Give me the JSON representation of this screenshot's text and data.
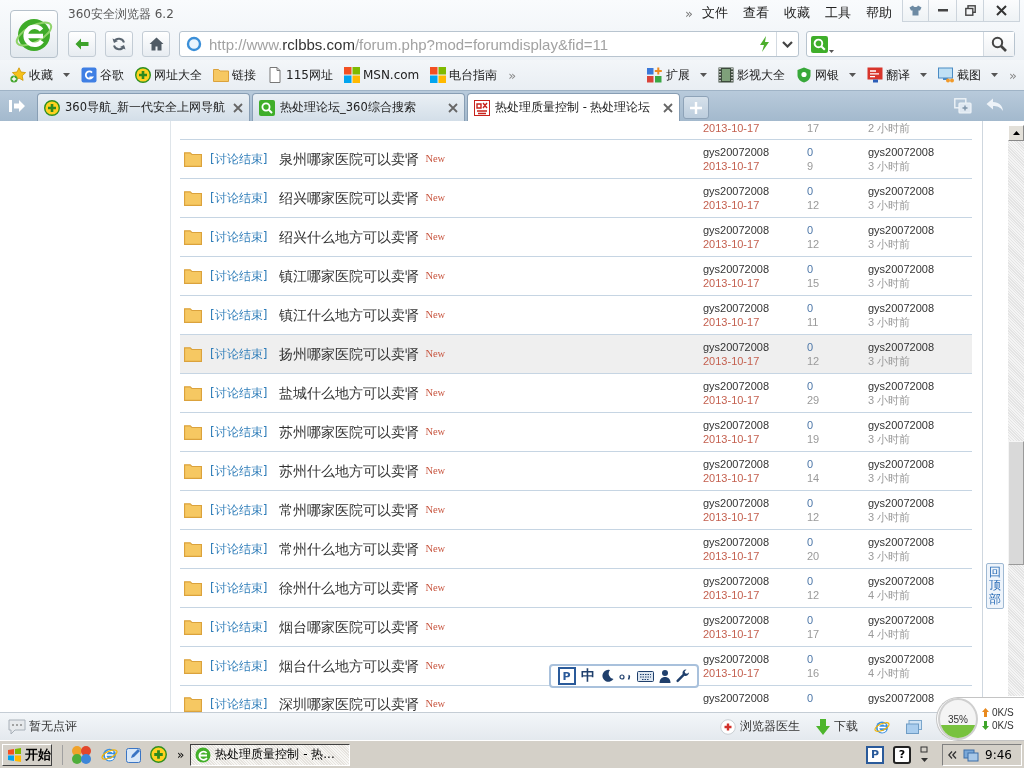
{
  "window": {
    "title": "360安全浏览器 6.2",
    "menu_more": "»",
    "menu": [
      "文件",
      "查看",
      "收藏",
      "工具",
      "帮助"
    ]
  },
  "address_bar": {
    "prefix": "http://www.",
    "domain": "rclbbs.com",
    "path": "/forum.php?mod=forumdisplay&fid=11"
  },
  "bookmarks": {
    "left": [
      {
        "kind": "favorites",
        "label": "收藏",
        "menu": true
      },
      {
        "kind": "search",
        "label": "谷歌",
        "menu": false
      },
      {
        "kind": "portal",
        "label": "网址大全",
        "menu": false
      },
      {
        "kind": "folder",
        "label": "链接",
        "menu": false
      },
      {
        "kind": "page",
        "label": "115网址",
        "menu": false
      },
      {
        "kind": "squares",
        "label": "MSN.com",
        "menu": false
      },
      {
        "kind": "squares",
        "label": "电台指南",
        "menu": false
      }
    ],
    "left_more": "»",
    "right": [
      {
        "kind": "extensions",
        "label": "扩展",
        "menu": true
      },
      {
        "kind": "video",
        "label": "影视大全",
        "menu": false
      },
      {
        "kind": "bank",
        "label": "网银",
        "menu": true
      },
      {
        "kind": "translate",
        "label": "翻译",
        "menu": true
      },
      {
        "kind": "screenshot",
        "label": "截图",
        "menu": true
      }
    ],
    "right_more": "»"
  },
  "tabs": [
    {
      "kind": "portal",
      "title": "360导航_新一代安全上网导航",
      "selected": false
    },
    {
      "kind": "search",
      "title": "热处理论坛_360综合搜索",
      "selected": false
    },
    {
      "kind": "forum",
      "title": "热处理质量控制 - 热处理论坛",
      "selected": true
    }
  ],
  "thread_list": {
    "rows": [
      {
        "kind": "partial_top",
        "date": "2013-10-17",
        "views": "17",
        "last_time": "2 小时前"
      },
      {
        "kind": "full",
        "prefix": "[讨论结束]",
        "title": "泉州哪家医院可以卖肾",
        "badge": "New",
        "author": "gys20072008",
        "date": "2013-10-17",
        "replies": "0",
        "views": "9",
        "last_poster": "gys20072008",
        "last_time": "3 小时前",
        "highlighted": false
      },
      {
        "kind": "full",
        "prefix": "[讨论结束]",
        "title": "绍兴哪家医院可以卖肾",
        "badge": "New",
        "author": "gys20072008",
        "date": "2013-10-17",
        "replies": "0",
        "views": "12",
        "last_poster": "gys20072008",
        "last_time": "3 小时前",
        "highlighted": false
      },
      {
        "kind": "full",
        "prefix": "[讨论结束]",
        "title": "绍兴什么地方可以卖肾",
        "badge": "New",
        "author": "gys20072008",
        "date": "2013-10-17",
        "replies": "0",
        "views": "12",
        "last_poster": "gys20072008",
        "last_time": "3 小时前",
        "highlighted": false
      },
      {
        "kind": "full",
        "prefix": "[讨论结束]",
        "title": "镇江哪家医院可以卖肾",
        "badge": "New",
        "author": "gys20072008",
        "date": "2013-10-17",
        "replies": "0",
        "views": "15",
        "last_poster": "gys20072008",
        "last_time": "3 小时前",
        "highlighted": false
      },
      {
        "kind": "full",
        "prefix": "[讨论结束]",
        "title": "镇江什么地方可以卖肾",
        "badge": "New",
        "author": "gys20072008",
        "date": "2013-10-17",
        "replies": "0",
        "views": "11",
        "last_poster": "gys20072008",
        "last_time": "3 小时前",
        "highlighted": false
      },
      {
        "kind": "full",
        "prefix": "[讨论结束]",
        "title": "扬州哪家医院可以卖肾",
        "badge": "New",
        "author": "gys20072008",
        "date": "2013-10-17",
        "replies": "0",
        "views": "12",
        "last_poster": "gys20072008",
        "last_time": "3 小时前",
        "highlighted": true
      },
      {
        "kind": "full",
        "prefix": "[讨论结束]",
        "title": "盐城什么地方可以卖肾",
        "badge": "New",
        "author": "gys20072008",
        "date": "2013-10-17",
        "replies": "0",
        "views": "29",
        "last_poster": "gys20072008",
        "last_time": "3 小时前",
        "highlighted": false
      },
      {
        "kind": "full",
        "prefix": "[讨论结束]",
        "title": "苏州哪家医院可以卖肾",
        "badge": "New",
        "author": "gys20072008",
        "date": "2013-10-17",
        "replies": "0",
        "views": "19",
        "last_poster": "gys20072008",
        "last_time": "3 小时前",
        "highlighted": false
      },
      {
        "kind": "full",
        "prefix": "[讨论结束]",
        "title": "苏州什么地方可以卖肾",
        "badge": "New",
        "author": "gys20072008",
        "date": "2013-10-17",
        "replies": "0",
        "views": "14",
        "last_poster": "gys20072008",
        "last_time": "3 小时前",
        "highlighted": false
      },
      {
        "kind": "full",
        "prefix": "[讨论结束]",
        "title": "常州哪家医院可以卖肾",
        "badge": "New",
        "author": "gys20072008",
        "date": "2013-10-17",
        "replies": "0",
        "views": "12",
        "last_poster": "gys20072008",
        "last_time": "3 小时前",
        "highlighted": false
      },
      {
        "kind": "full",
        "prefix": "[讨论结束]",
        "title": "常州什么地方可以卖肾",
        "badge": "New",
        "author": "gys20072008",
        "date": "2013-10-17",
        "replies": "0",
        "views": "20",
        "last_poster": "gys20072008",
        "last_time": "3 小时前",
        "highlighted": false
      },
      {
        "kind": "full",
        "prefix": "[讨论结束]",
        "title": "徐州什么地方可以卖肾",
        "badge": "New",
        "author": "gys20072008",
        "date": "2013-10-17",
        "replies": "0",
        "views": "12",
        "last_poster": "gys20072008",
        "last_time": "4 小时前",
        "highlighted": false
      },
      {
        "kind": "full",
        "prefix": "[讨论结束]",
        "title": "烟台哪家医院可以卖肾",
        "badge": "New",
        "author": "gys20072008",
        "date": "2013-10-17",
        "replies": "0",
        "views": "17",
        "last_poster": "gys20072008",
        "last_time": "4 小时前",
        "highlighted": false
      },
      {
        "kind": "full",
        "prefix": "[讨论结束]",
        "title": "烟台什么地方可以卖肾",
        "badge": "New",
        "author": "gys20072008",
        "date": "2013-10-17",
        "replies": "0",
        "views": "16",
        "last_poster": "gys20072008",
        "last_time": "4 小时前",
        "highlighted": false
      },
      {
        "kind": "partial_bottom",
        "prefix": "[讨论结束]",
        "title": "深圳哪家医院可以卖肾",
        "badge": "New",
        "author": "gys20072008",
        "replies": "0",
        "last_poster": "gys20072008"
      }
    ]
  },
  "back_to_top": "回顶部",
  "ime_toolbar": {
    "logo": "P",
    "mode": "中"
  },
  "status_bar": {
    "comment": "暂无点评",
    "doctor": "浏览器医生",
    "download": "下载"
  },
  "speed_ball": {
    "level": 0.35,
    "percent": "35%",
    "upload": "0K/S",
    "download": "0K/S"
  },
  "taskbar": {
    "start": "开始",
    "more": "»",
    "tasks": [
      {
        "title": "热处理质量控制 - 热...",
        "selected": true
      }
    ],
    "tray": {
      "ime": "P",
      "help": "?",
      "clock": "9:46"
    }
  }
}
